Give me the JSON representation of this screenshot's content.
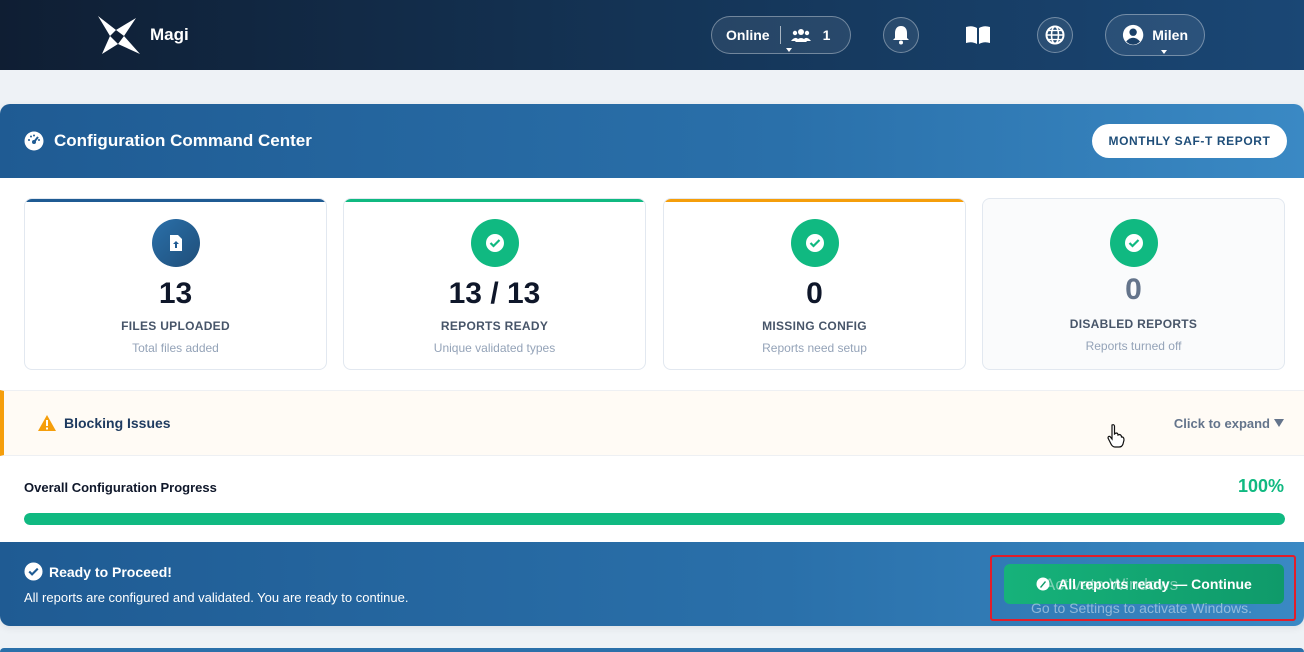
{
  "nav": {
    "brand": "Magi",
    "online_label": "Online",
    "online_count": "1",
    "user_name": "Milen"
  },
  "header": {
    "title": "Configuration Command Center",
    "report_button": "MONTHLY SAF-T REPORT"
  },
  "stats": [
    {
      "value": "13",
      "label": "FILES UPLOADED",
      "sub": "Total files added",
      "accent": "#1f5b93"
    },
    {
      "value": "13 / 13",
      "label": "REPORTS READY",
      "sub": "Unique validated types",
      "accent": "#10b981"
    },
    {
      "value": "0",
      "label": "MISSING CONFIG",
      "sub": "Reports need setup",
      "accent": "#f59e0b"
    },
    {
      "value": "0",
      "label": "DISABLED REPORTS",
      "sub": "Reports turned off",
      "accent": "#e2e8f0"
    }
  ],
  "blocking": {
    "title": "Blocking Issues",
    "expand_label": "Click to expand"
  },
  "progress": {
    "title": "Overall Configuration Progress",
    "percent_label": "100%",
    "fraction": 1.0
  },
  "ready": {
    "title": "Ready to Proceed!",
    "text": "All reports are configured and validated. You are ready to continue.",
    "continue_label": "All reports ready — Continue"
  },
  "watermark": {
    "line1": "Activate Windows",
    "line2": "Go to Settings to activate Windows."
  },
  "colors": {
    "success": "#10b981",
    "warning": "#f59e0b",
    "primary": "#1f5b93"
  }
}
